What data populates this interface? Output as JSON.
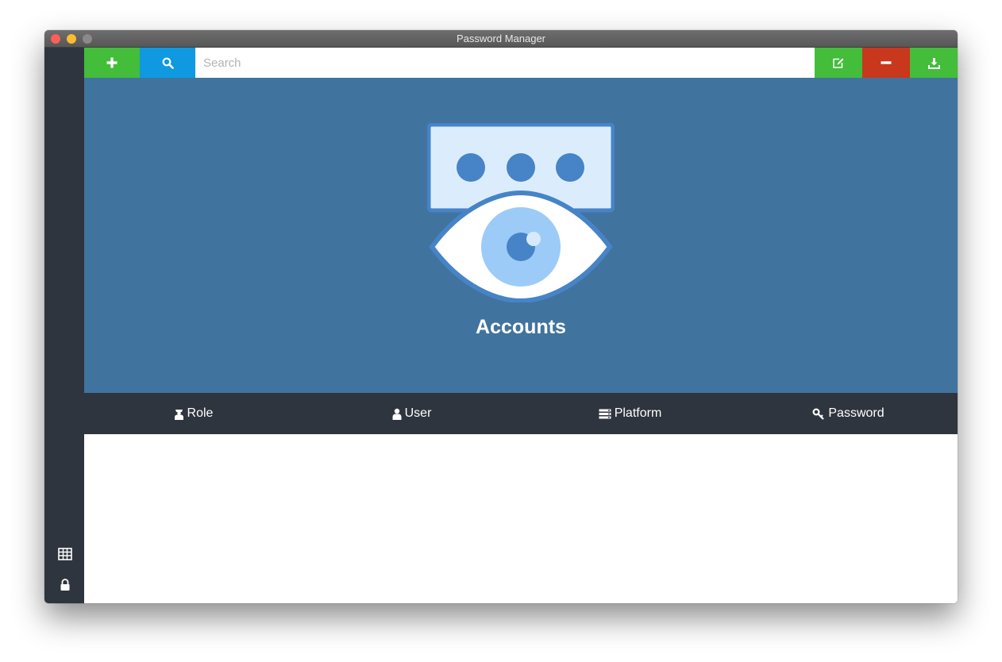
{
  "window": {
    "title": "Password Manager"
  },
  "toolbar": {
    "add_icon": "plus-icon",
    "search_icon": "search-icon",
    "search_placeholder": "Search",
    "search_value": "",
    "edit_icon": "edit-icon",
    "remove_icon": "minus-icon",
    "download_icon": "download-icon"
  },
  "hero": {
    "title": "Accounts",
    "icon": "password-eye-icon"
  },
  "columns": [
    {
      "label": "Role",
      "icon": "role-icon"
    },
    {
      "label": "User",
      "icon": "user-icon"
    },
    {
      "label": "Platform",
      "icon": "server-icon"
    },
    {
      "label": "Password",
      "icon": "key-icon"
    }
  ],
  "sidebar": {
    "items": [
      {
        "icon": "table-icon"
      },
      {
        "icon": "lock-icon"
      }
    ]
  },
  "colors": {
    "green": "#43bd3a",
    "blue": "#0f99e0",
    "red": "#c9371c",
    "hero_bg": "#41739f",
    "dark": "#2f353e"
  }
}
